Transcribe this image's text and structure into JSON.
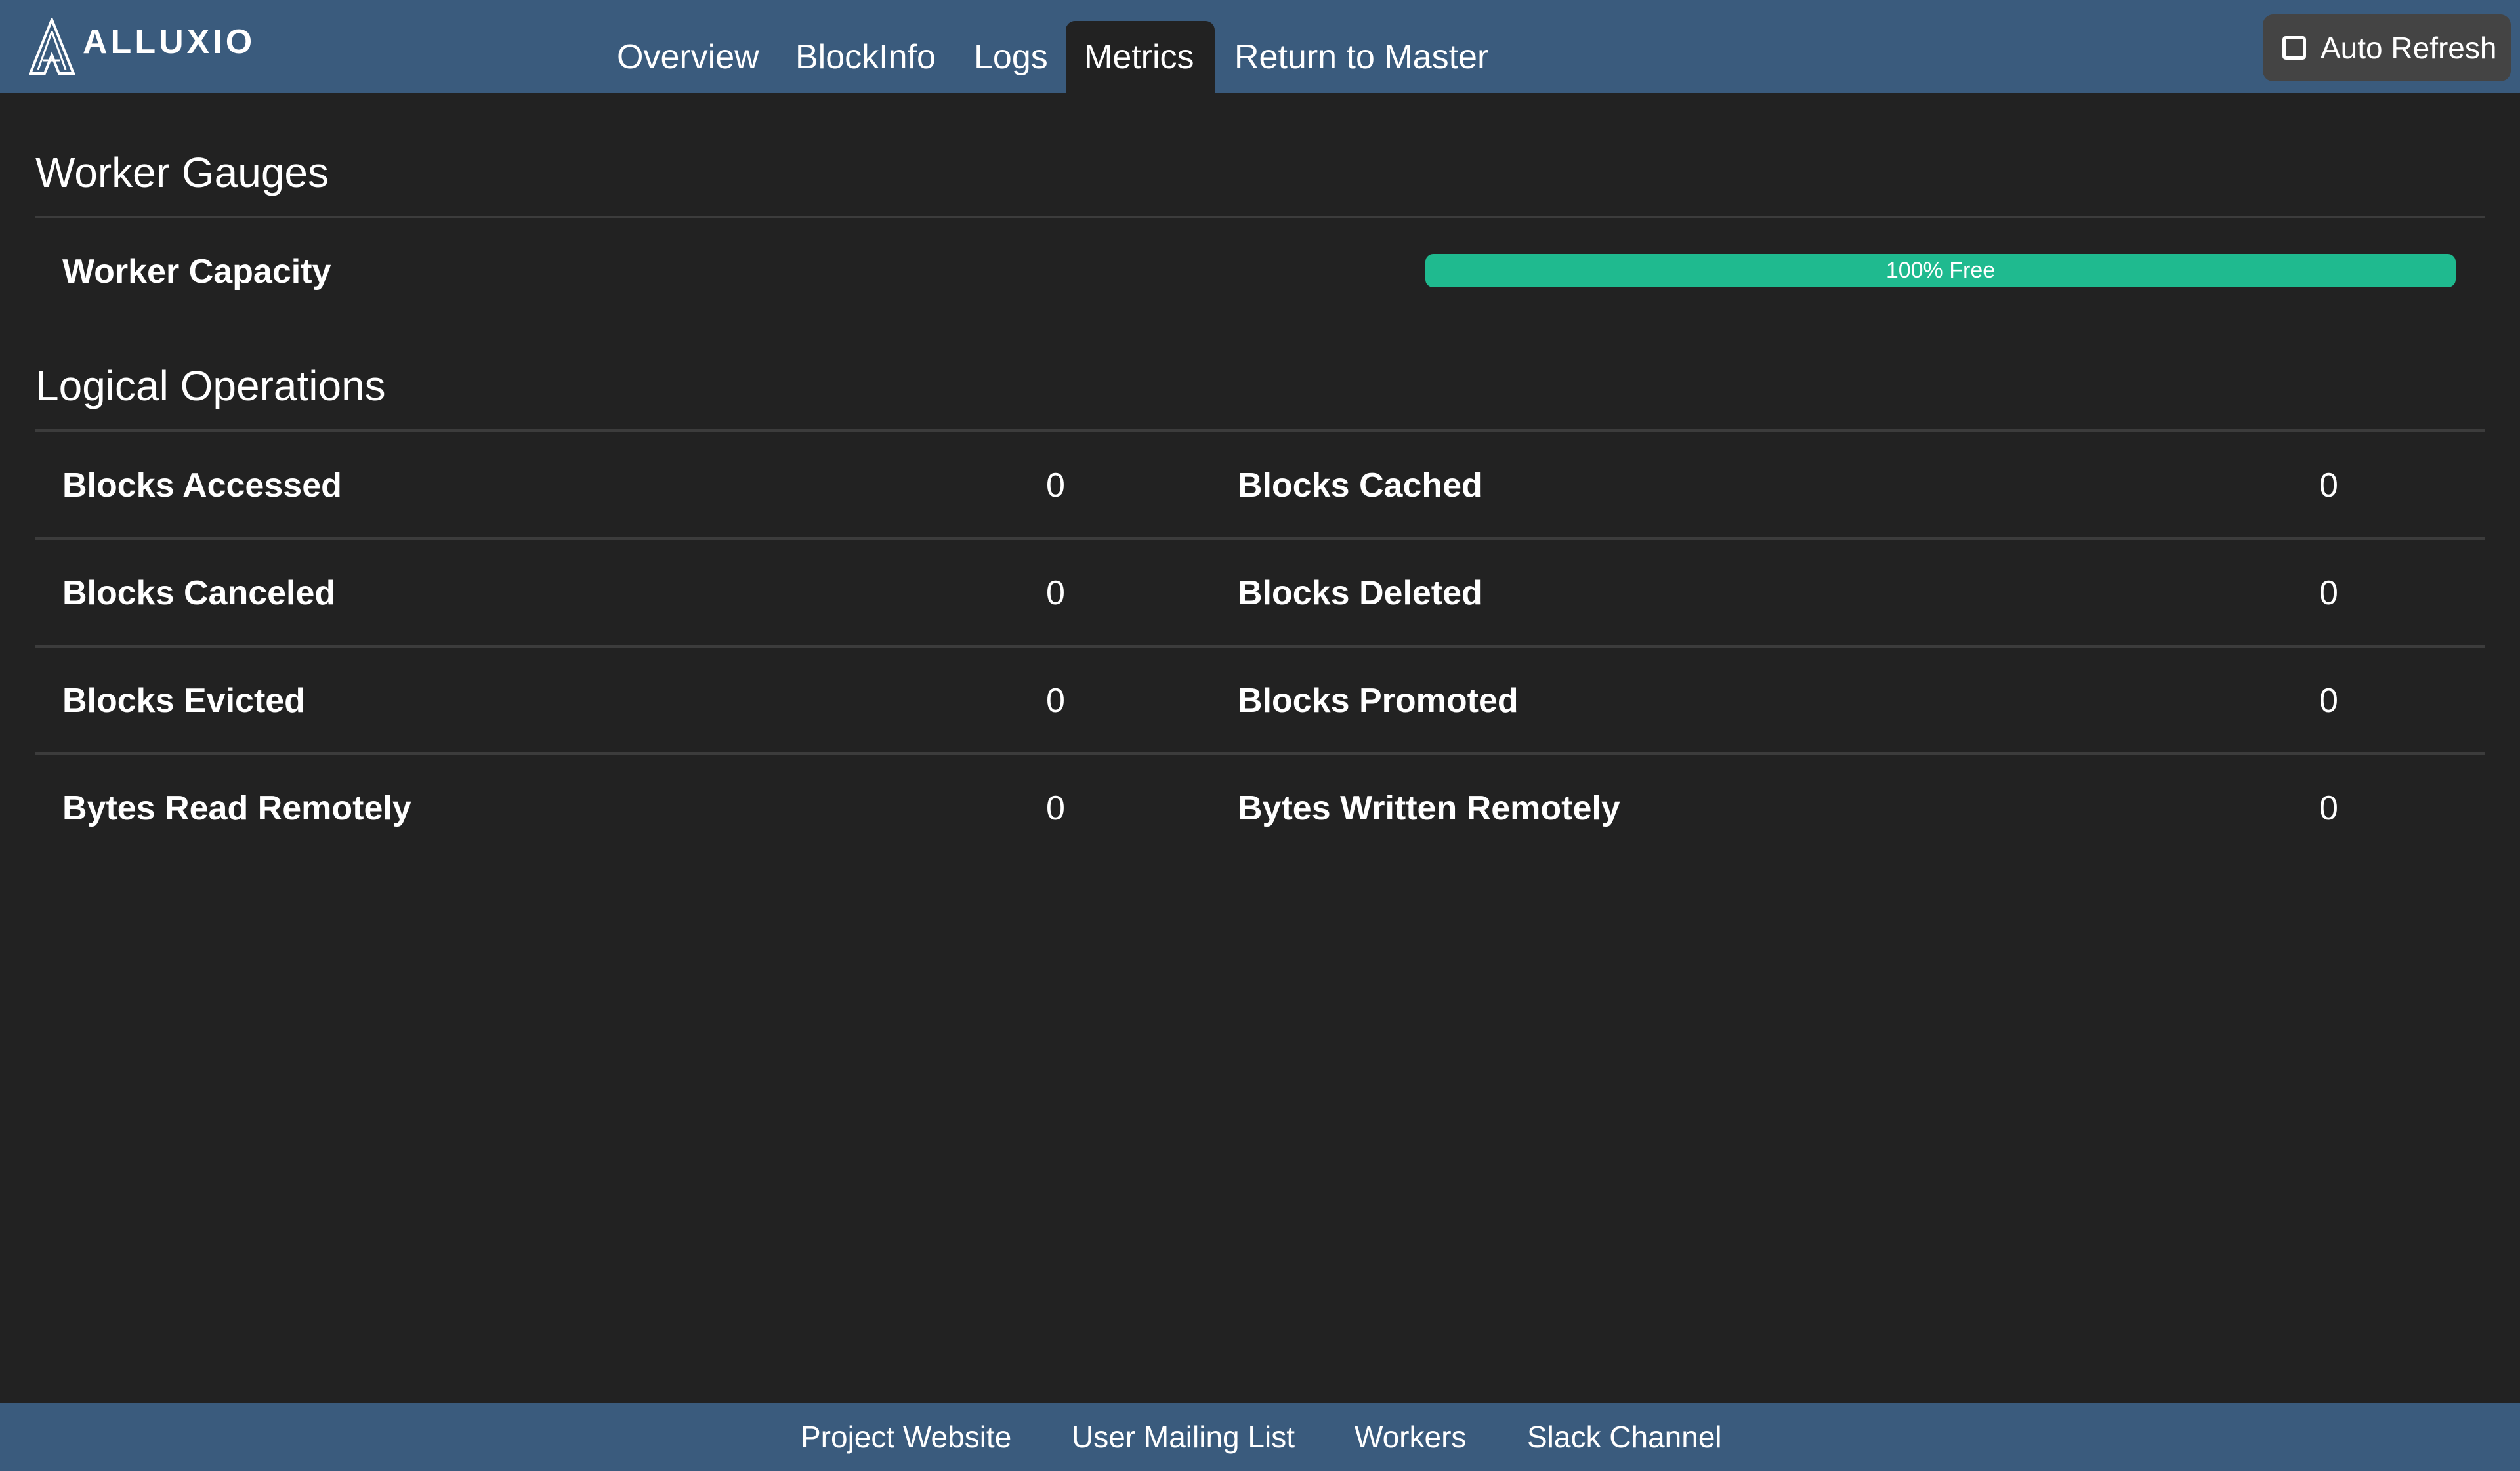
{
  "header": {
    "logo_text": "ALLUXIO",
    "nav": [
      {
        "label": "Overview",
        "active": false
      },
      {
        "label": "BlockInfo",
        "active": false
      },
      {
        "label": "Logs",
        "active": false
      },
      {
        "label": "Metrics",
        "active": true
      },
      {
        "label": "Return to Master",
        "active": false
      }
    ],
    "auto_refresh": {
      "label": "Auto Refresh",
      "checked": false
    }
  },
  "worker_gauges": {
    "title": "Worker Gauges",
    "capacity_label": "Worker Capacity",
    "capacity_free_percent": 100,
    "capacity_text": "100% Free",
    "bar_color": "#1fba8f"
  },
  "logical_operations": {
    "title": "Logical Operations",
    "rows": [
      {
        "left_label": "Blocks Accessed",
        "left_value": "0",
        "right_label": "Blocks Cached",
        "right_value": "0"
      },
      {
        "left_label": "Blocks Canceled",
        "left_value": "0",
        "right_label": "Blocks Deleted",
        "right_value": "0"
      },
      {
        "left_label": "Blocks Evicted",
        "left_value": "0",
        "right_label": "Blocks Promoted",
        "right_value": "0"
      },
      {
        "left_label": "Bytes Read Remotely",
        "left_value": "0",
        "right_label": "Bytes Written Remotely",
        "right_value": "0"
      }
    ]
  },
  "footer": {
    "links": [
      "Project Website",
      "User Mailing List",
      "Workers",
      "Slack Channel"
    ]
  }
}
